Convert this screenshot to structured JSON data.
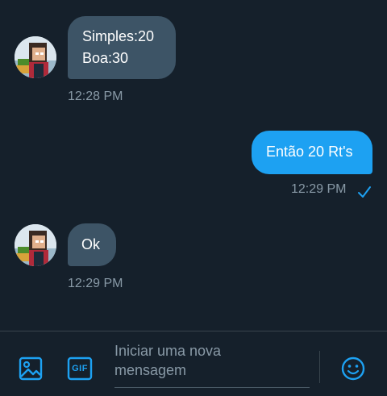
{
  "messages": [
    {
      "direction": "incoming",
      "lines": [
        "Simples:20",
        "Boa:30"
      ],
      "time": "12:28 PM"
    },
    {
      "direction": "outgoing",
      "lines": [
        "Então 20 Rt's"
      ],
      "time": "12:29 PM",
      "status_icon": "check-icon"
    },
    {
      "direction": "incoming",
      "lines": [
        "Ok"
      ],
      "time": "12:29 PM"
    }
  ],
  "composer": {
    "placeholder_line1": "Iniciar uma nova",
    "placeholder_line2": "mensagem",
    "icons": [
      "image-icon",
      "gif-icon",
      "emoji-icon"
    ],
    "gif_label": "GIF"
  },
  "colors": {
    "background": "#15202b",
    "incoming_bubble": "#3d5466",
    "outgoing_bubble": "#1da1f2",
    "accent": "#1da1f2",
    "timestamp": "#8899a6"
  }
}
